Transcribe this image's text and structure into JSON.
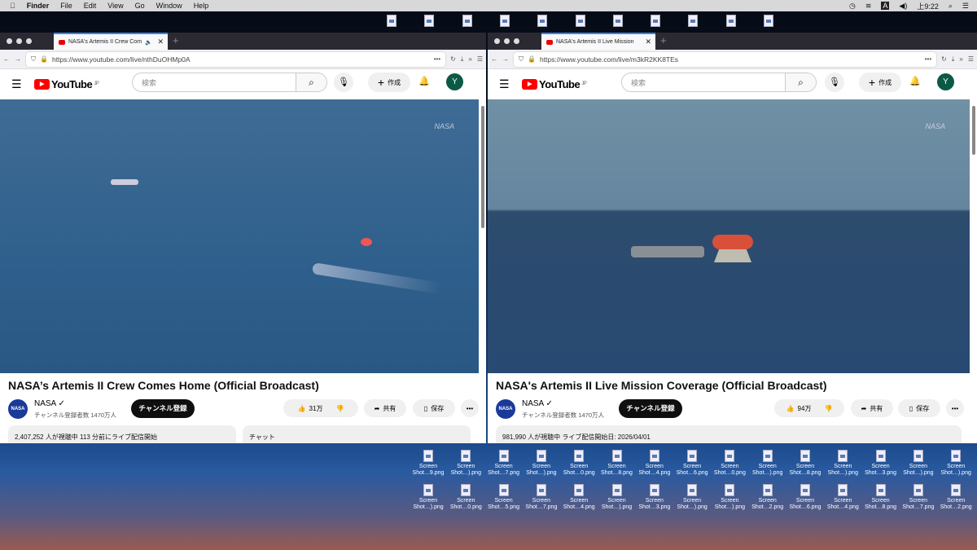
{
  "menubar": {
    "app": "Finder",
    "items": [
      "File",
      "Edit",
      "View",
      "Go",
      "Window",
      "Help"
    ],
    "time": "上9:22",
    "input": "A"
  },
  "desktop": {
    "icon_label": "Screen",
    "row1": [
      "Shot…9.png",
      "Shot…).png",
      "Shot…7.png",
      "Shot…).png",
      "Shot…0.png",
      "Shot…8.png",
      "Shot…4.png",
      "Shot…6.png",
      "Shot…0.png",
      "Shot…).png",
      "Shot…8.png",
      "Shot…).png",
      "Shot…3.png",
      "Shot…).png",
      "Shot…).png"
    ],
    "row2": [
      "Shot…).png",
      "Shot…0.png",
      "Shot…5.png",
      "Shot…7.png",
      "Shot…4.png",
      "Shot…).png",
      "Shot…3.png",
      "Shot…).png",
      "Shot…).png",
      "Shot…2.png",
      "Shot…6.png",
      "Shot…4.png",
      "Shot…8.png",
      "Shot…7.png",
      "Shot…2.png"
    ]
  },
  "youtube": {
    "search_placeholder": "検索",
    "create": "作成",
    "avatar": "Y",
    "region": "JP",
    "subscribe": "チャンネル登録",
    "share": "共有",
    "save": "保存",
    "channel": "NASA",
    "subs": "チャンネル登録者数 1470万人"
  },
  "left": {
    "tab": "NASA's Artemis II Crew Com",
    "url": "https://www.youtube.com/live/nthDuOHMp0A",
    "title": "NASA’s Artemis II Crew Comes Home (Official Broadcast)",
    "likes": "31万",
    "views": "2,407,252 人が視聴中  113 分前にライブ配信開始",
    "chat": "チャット"
  },
  "right": {
    "tab": "NASA's Artemis II Live Mission",
    "url": "https://www.youtube.com/live/m3kR2KK8TEs",
    "title": "NASA's Artemis II Live Mission Coverage (Official Broadcast)",
    "likes": "94万",
    "views": "981,990 人が視聴中  ライブ配信開始日: 2026/04/01"
  }
}
